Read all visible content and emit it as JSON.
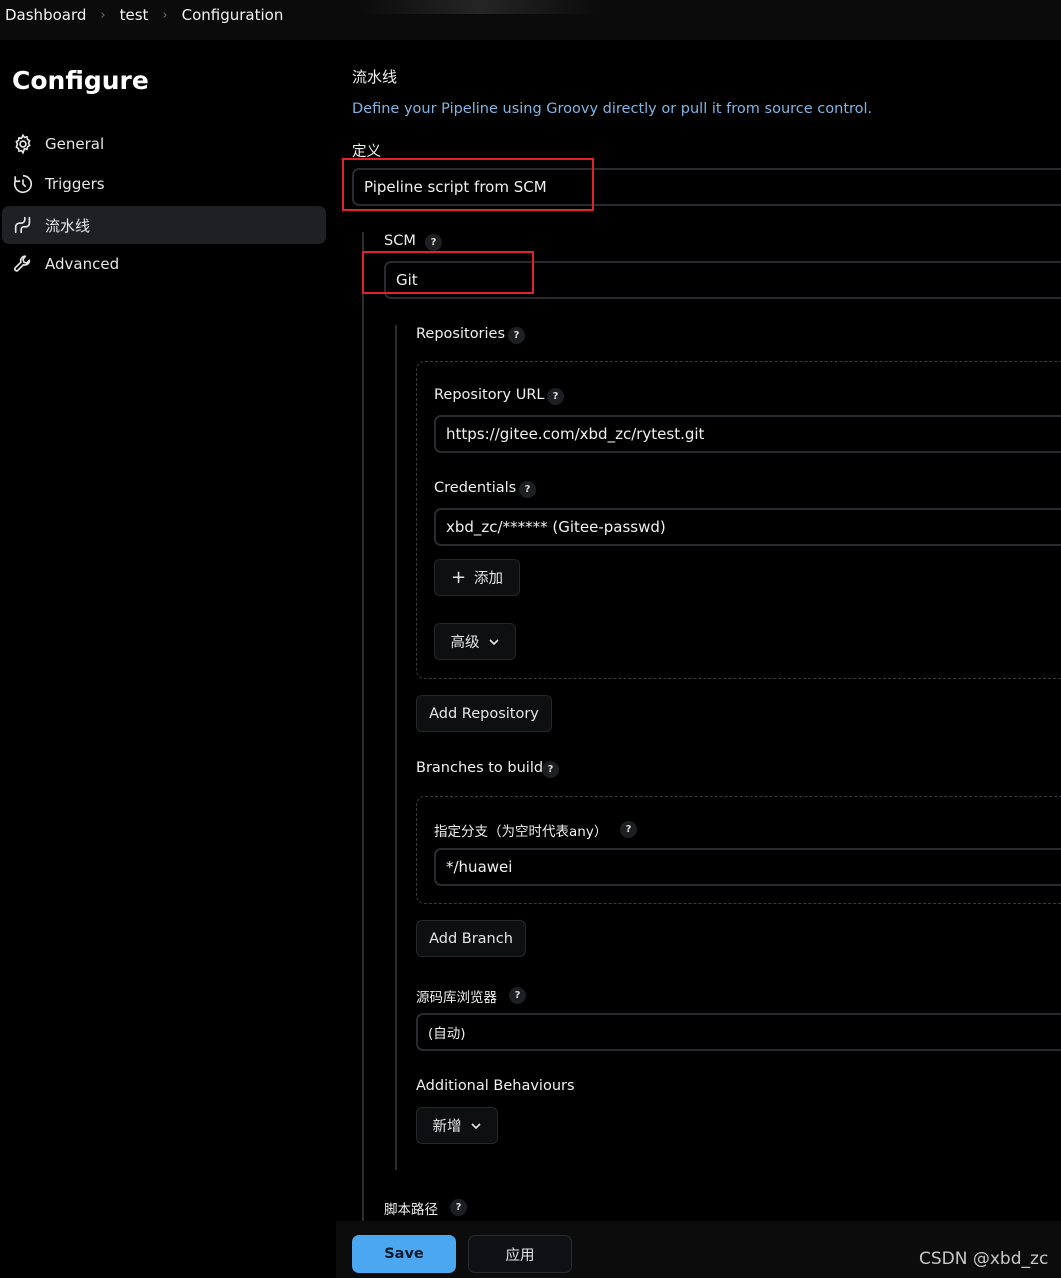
{
  "breadcrumb": [
    "Dashboard",
    "test",
    "Configuration"
  ],
  "sidebar": {
    "title": "Configure",
    "items": [
      {
        "label": "General",
        "icon": "gear-icon"
      },
      {
        "label": "Triggers",
        "icon": "clock-icon"
      },
      {
        "label": "流水线",
        "icon": "pipeline-icon",
        "active": true
      },
      {
        "label": "Advanced",
        "icon": "wrench-icon"
      }
    ]
  },
  "pipeline": {
    "section_title": "流水线",
    "description": "Define your Pipeline using Groovy directly or pull it from source control.",
    "definition_label": "定义",
    "definition_value": "Pipeline script from SCM",
    "scm_label": "SCM",
    "scm_value": "Git",
    "repositories_label": "Repositories",
    "repo_url_label": "Repository URL",
    "repo_url_value": "https://gitee.com/xbd_zc/rytest.git",
    "credentials_label": "Credentials",
    "credentials_value": "xbd_zc/****** (Gitee-passwd)",
    "add_credential_label": "添加",
    "advanced_label": "高级",
    "add_repository_label": "Add Repository",
    "branches_label": "Branches to build",
    "branch_specifier_label": "指定分支（为空时代表any）",
    "branch_value": "*/huawei",
    "add_branch_label": "Add Branch",
    "repo_browser_label": "源码库浏览器",
    "repo_browser_value": "(自动)",
    "additional_behaviours_label": "Additional Behaviours",
    "add_behaviour_label": "新增",
    "script_path_label": "脚本路径",
    "help_symbol": "?"
  },
  "footer": {
    "save_label": "Save",
    "apply_label": "应用"
  },
  "watermark": "CSDN @xbd_zc",
  "colors": {
    "background": "#000000",
    "accent_save": "#4aa7f0",
    "highlight_box": "#e0222a",
    "description_text": "#7eb6e6"
  }
}
